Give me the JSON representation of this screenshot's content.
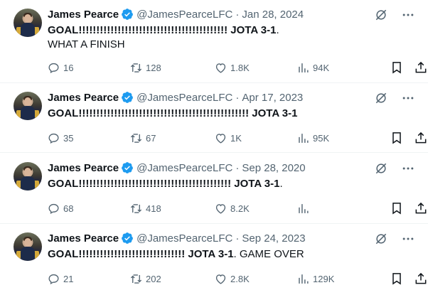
{
  "tweets": [
    {
      "name": "James Pearce",
      "handle": "@JamesPearceLFC",
      "date": "Jan 28, 2024",
      "text_bold": "GOAL!!!!!!!!!!!!!!!!!!!!!!!!!!!!!!!!!!!!!!!!!! JOTA 3-1",
      "text_rest": ".\nWHAT A FINISH",
      "replies": "16",
      "retweets": "128",
      "likes": "1.8K",
      "views": "94K"
    },
    {
      "name": "James Pearce",
      "handle": "@JamesPearceLFC",
      "date": "Apr 17, 2023",
      "text_bold": "GOAL!!!!!!!!!!!!!!!!!!!!!!!!!!!!!!!!!!!!!!!!!!!!!!!! JOTA 3-1",
      "text_rest": "",
      "replies": "35",
      "retweets": "67",
      "likes": "1K",
      "views": "95K"
    },
    {
      "name": "James Pearce",
      "handle": "@JamesPearceLFC",
      "date": "Sep 28, 2020",
      "text_bold": "GOAL!!!!!!!!!!!!!!!!!!!!!!!!!!!!!!!!!!!!!!!!!!! JOTA 3-1",
      "text_rest": ".",
      "replies": "68",
      "retweets": "418",
      "likes": "8.2K",
      "views": ""
    },
    {
      "name": "James Pearce",
      "handle": "@JamesPearceLFC",
      "date": "Sep 24, 2023",
      "text_bold": "GOAL!!!!!!!!!!!!!!!!!!!!!!!!!!!!!! JOTA 3-1",
      "text_rest": ". GAME OVER",
      "replies": "21",
      "retweets": "202",
      "likes": "2.8K",
      "views": "129K"
    }
  ],
  "icons": {
    "verified": "verified-badge-icon",
    "grok": "grok-icon",
    "more": "more-icon",
    "reply": "reply-icon",
    "retweet": "retweet-icon",
    "like": "like-icon",
    "views": "views-icon",
    "bookmark": "bookmark-icon",
    "share": "share-icon"
  },
  "colors": {
    "verified": "#1d9bf0",
    "text": "#0f1419",
    "muted": "#536471",
    "divider": "#eff3f4"
  }
}
